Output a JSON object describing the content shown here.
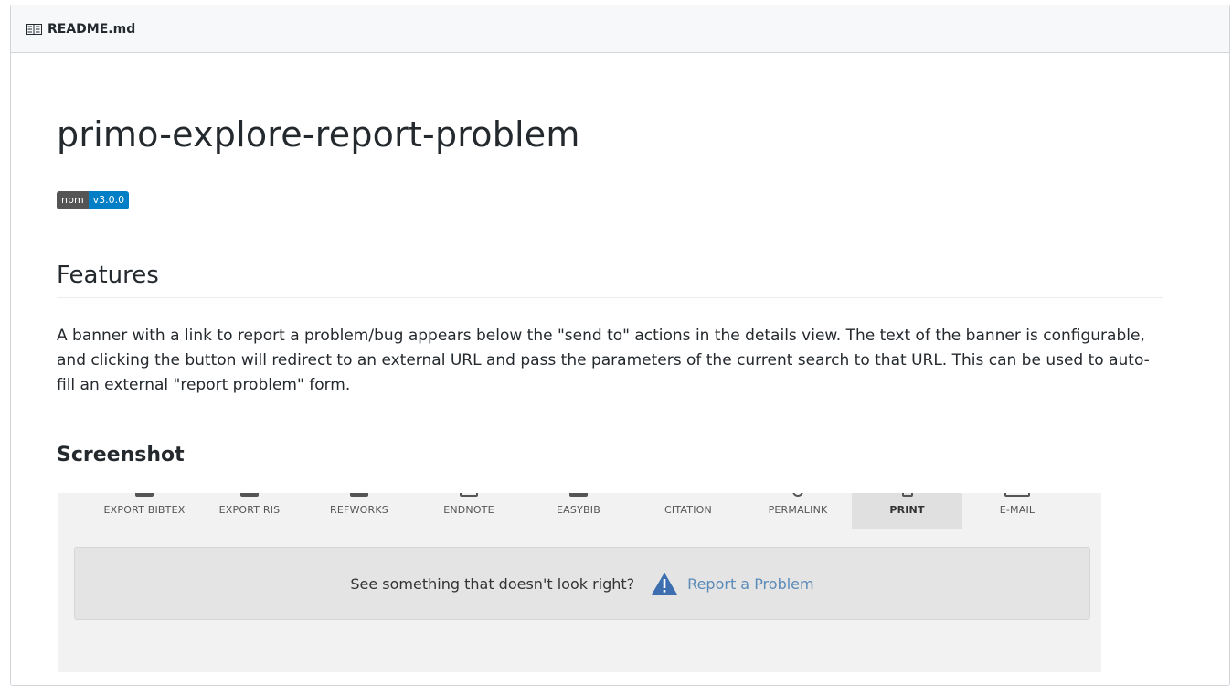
{
  "header": {
    "title": "README.md"
  },
  "readme": {
    "title": "primo-explore-report-problem",
    "badge": {
      "left": "npm",
      "right": "v3.0.0",
      "left_color": "#555555",
      "right_color": "#007ec6"
    },
    "features_heading": "Features",
    "features_text": "A banner with a link to report a problem/bug appears below the \"send to\" actions in the details view. The text of the banner is configurable, and clicking the button will redirect to an external URL and pass the parameters of the current search to that URL. This can be used to auto-fill an external \"report problem\" form.",
    "screenshot_heading": "Screenshot"
  },
  "screenshot": {
    "actions": [
      {
        "label": "EXPORT BIBTEX",
        "icon": "export-bibtex-icon"
      },
      {
        "label": "EXPORT RIS",
        "icon": "export-ris-icon"
      },
      {
        "label": "REFWORKS",
        "icon": "refworks-icon"
      },
      {
        "label": "ENDNOTE",
        "icon": "endnote-icon"
      },
      {
        "label": "EASYBIB",
        "icon": "easybib-icon"
      },
      {
        "label": "CITATION",
        "icon": "citation-icon"
      },
      {
        "label": "PERMALINK",
        "icon": "permalink-icon"
      },
      {
        "label": "PRINT",
        "icon": "print-icon",
        "active": true
      },
      {
        "label": "E-MAIL",
        "icon": "email-icon"
      }
    ],
    "banner_text": "See something that doesn't look right?",
    "report_link": "Report a Problem",
    "warning_icon_color": "#3d6fb0",
    "link_color": "#5b8bb8"
  }
}
